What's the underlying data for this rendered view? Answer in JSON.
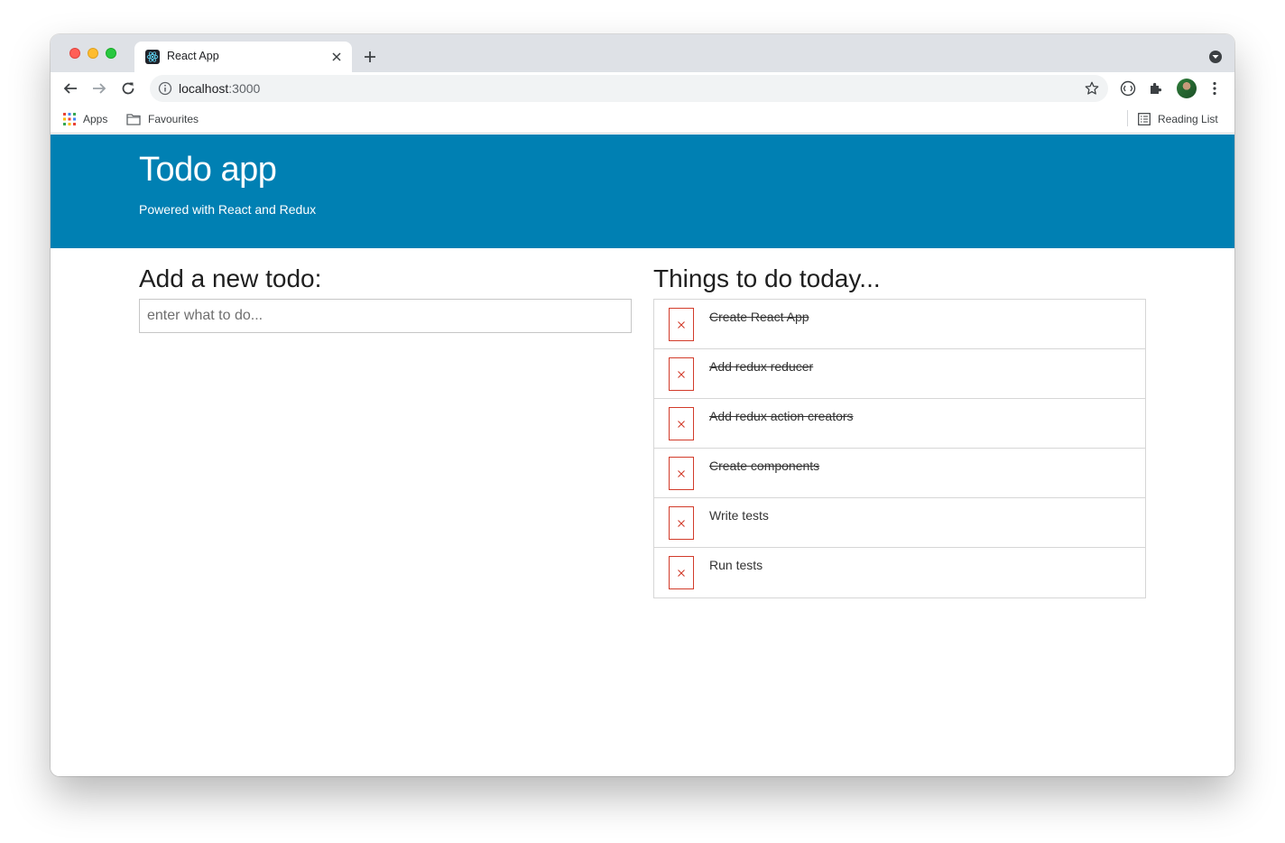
{
  "browser": {
    "tab_title": "React App",
    "url_host": "localhost",
    "url_port": ":3000",
    "bookmarks": [
      {
        "label": "Apps",
        "icon": "apps-grid-icon"
      },
      {
        "label": "Favourites",
        "icon": "folder-icon"
      }
    ],
    "reading_list_label": "Reading List"
  },
  "header": {
    "title": "Todo app",
    "subtitle": "Powered with React and Redux"
  },
  "add_todo": {
    "heading": "Add a new todo:",
    "placeholder": "enter what to do..."
  },
  "todo_list": {
    "heading": "Things to do today...",
    "items": [
      {
        "text": "Create React App",
        "done": true
      },
      {
        "text": "Add redux reducer",
        "done": true
      },
      {
        "text": "Add redux action creators",
        "done": true
      },
      {
        "text": "Create components",
        "done": true
      },
      {
        "text": "Write tests",
        "done": false
      },
      {
        "text": "Run tests",
        "done": false
      }
    ]
  },
  "colors": {
    "header_bg": "#0080b3",
    "delete_red": "#d23b2a"
  }
}
